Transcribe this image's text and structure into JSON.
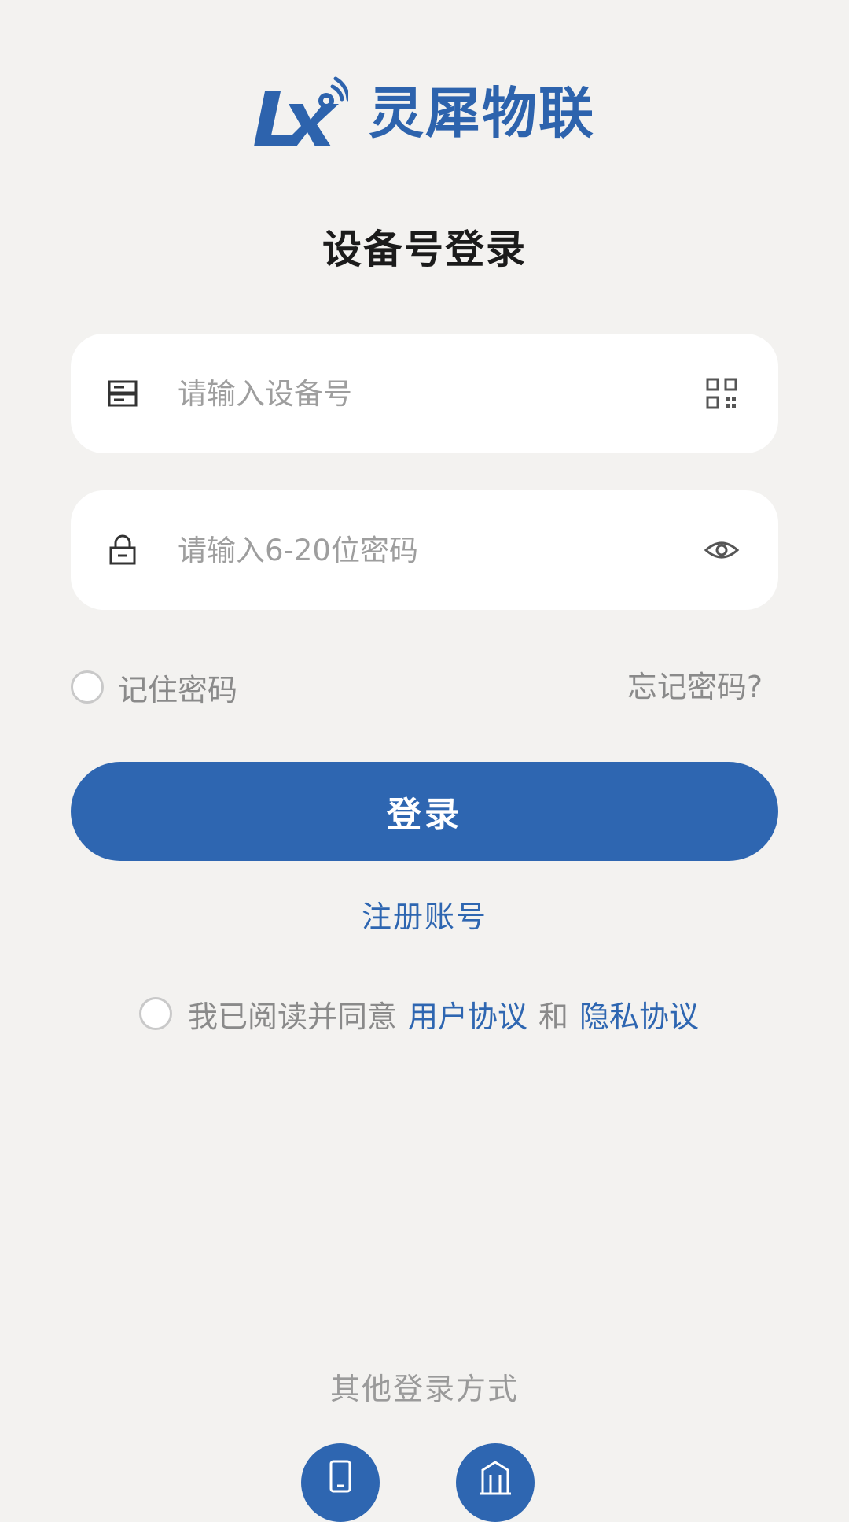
{
  "logo": {
    "mark_text": "LX",
    "name": "灵犀物联"
  },
  "page_title": "设备号登录",
  "device_field": {
    "placeholder": "请输入设备号",
    "value": "",
    "lead_icon": "device-card-icon",
    "trail_icon": "qr-code-icon"
  },
  "password_field": {
    "placeholder": "请输入6-20位密码",
    "value": "",
    "lead_icon": "lock-icon",
    "trail_icon": "eye-icon"
  },
  "remember": {
    "label": "记住密码",
    "checked": false
  },
  "forgot_label": "忘记密码?",
  "login_label": "登录",
  "register_label": "注册账号",
  "agreement": {
    "checked": false,
    "prefix": "我已阅读并同意",
    "user_agreement": "用户协议",
    "and": "和",
    "privacy_agreement": "隐私协议"
  },
  "other_login": {
    "title": "其他登录方式",
    "options": [
      "phone-icon",
      "building-icon"
    ]
  },
  "colors": {
    "primary": "#2e66b1",
    "background": "#f3f2f0",
    "card": "#ffffff",
    "muted_text": "#8a8a8a",
    "title_text": "#1b1b1b"
  }
}
